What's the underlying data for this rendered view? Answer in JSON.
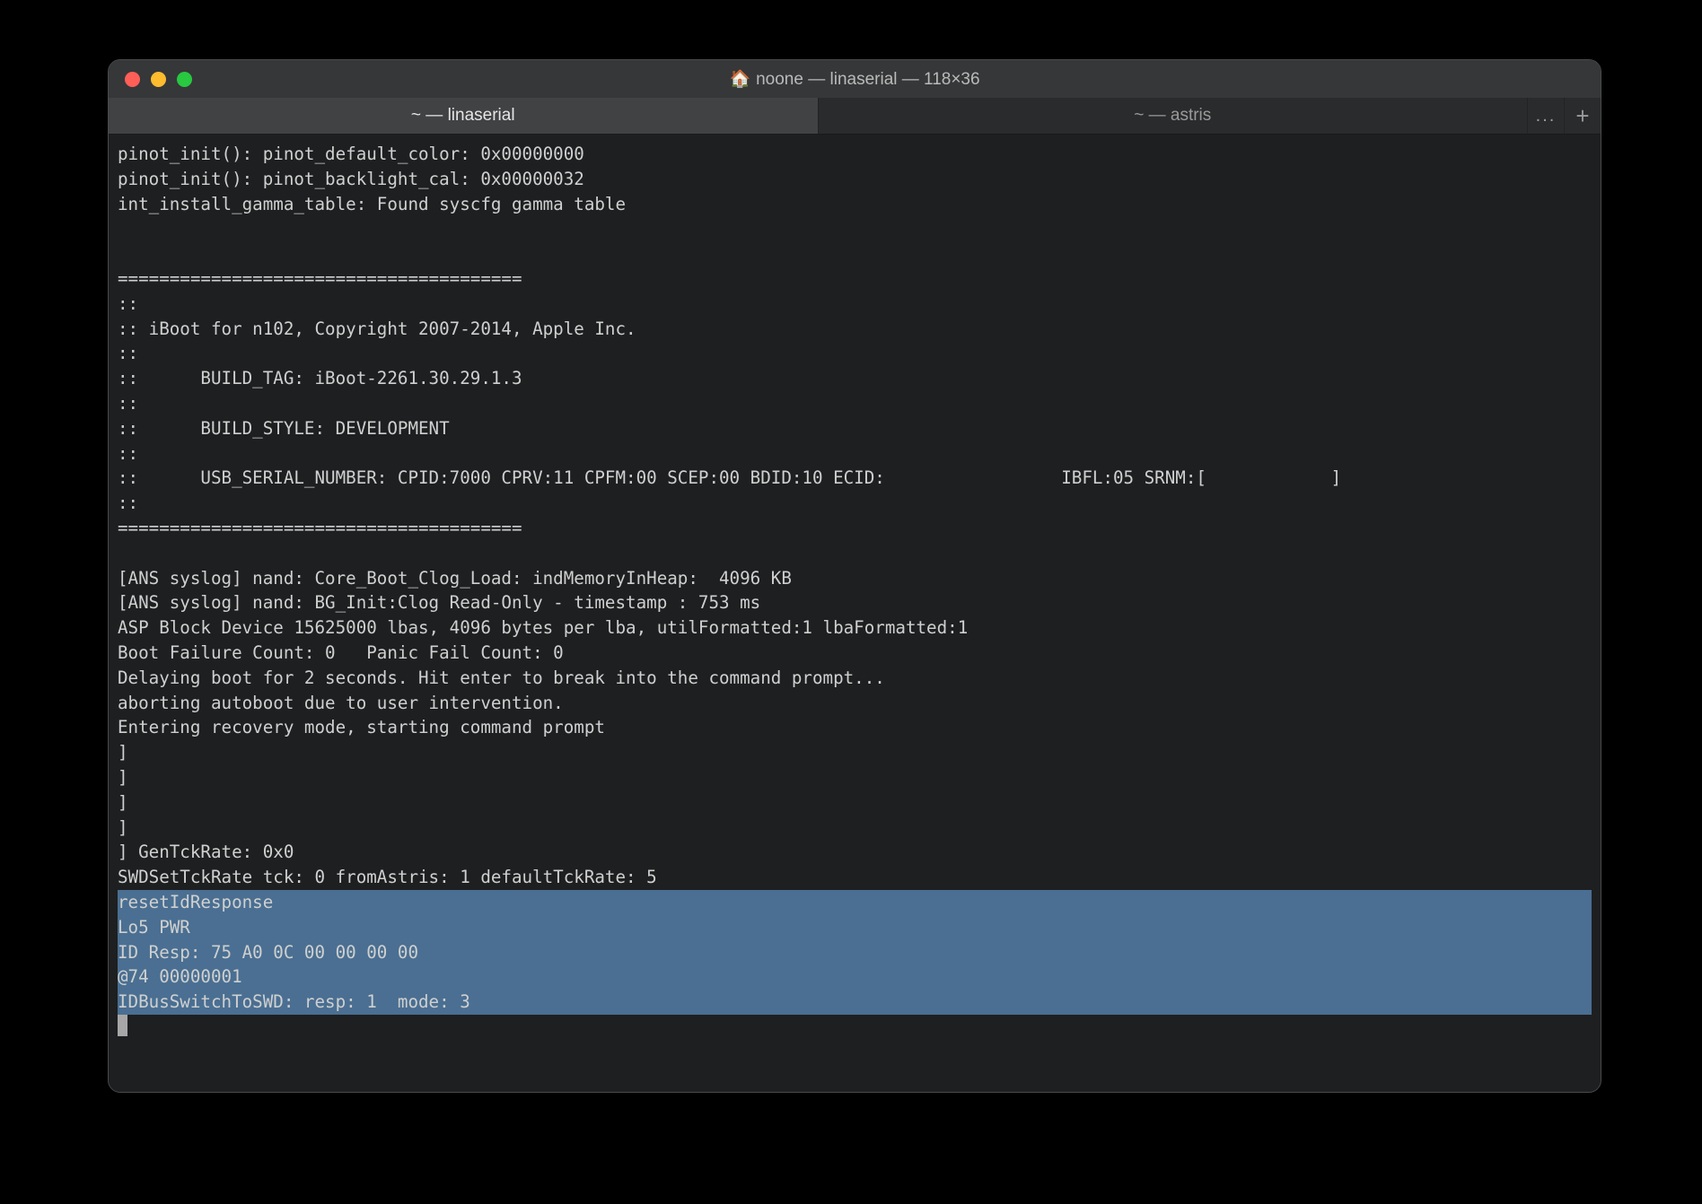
{
  "window": {
    "title": "noone — linaserial — 118×36",
    "traffic_colors": {
      "close": "#ff5f57",
      "minimize": "#febc2e",
      "zoom": "#28c840"
    }
  },
  "tabs": [
    {
      "label": "~ — linaserial",
      "active": true
    },
    {
      "label": "~ — astris",
      "active": false
    }
  ],
  "tabbar": {
    "overflow_label": "...",
    "newtab_label": "+"
  },
  "terminal": {
    "lines": [
      "pinot_init(): pinot_default_color: 0x00000000",
      "pinot_init(): pinot_backlight_cal: 0x00000032",
      "int_install_gamma_table: Found syscfg gamma table",
      "",
      "",
      "=======================================",
      "::",
      ":: iBoot for n102, Copyright 2007-2014, Apple Inc.",
      "::",
      "::      BUILD_TAG: iBoot-2261.30.29.1.3",
      "::",
      "::      BUILD_STYLE: DEVELOPMENT",
      "::",
      "::      USB_SERIAL_NUMBER: CPID:7000 CPRV:11 CPFM:00 SCEP:00 BDID:10 ECID:                 IBFL:05 SRNM:[            ]",
      "::",
      "=======================================",
      "",
      "[ANS syslog] nand: Core_Boot_Clog_Load: indMemoryInHeap:  4096 KB",
      "[ANS syslog] nand: BG_Init:Clog Read-Only - timestamp : 753 ms",
      "ASP Block Device 15625000 lbas, 4096 bytes per lba, utilFormatted:1 lbaFormatted:1",
      "Boot Failure Count: 0   Panic Fail Count: 0",
      "Delaying boot for 2 seconds. Hit enter to break into the command prompt...",
      "aborting autoboot due to user intervention.",
      "Entering recovery mode, starting command prompt",
      "]",
      "]",
      "]",
      "]",
      "] GenTckRate: 0x0",
      "SWDSetTckRate tck: 0 fromAstris: 1 defaultTckRate: 5"
    ],
    "selected_lines": [
      "resetIdResponse",
      "Lo5 PWR",
      "ID Resp: 75 A0 0C 00 00 00 00",
      "@74 00000001",
      "IDBusSwitchToSWD: resp: 1  mode: 3"
    ]
  }
}
